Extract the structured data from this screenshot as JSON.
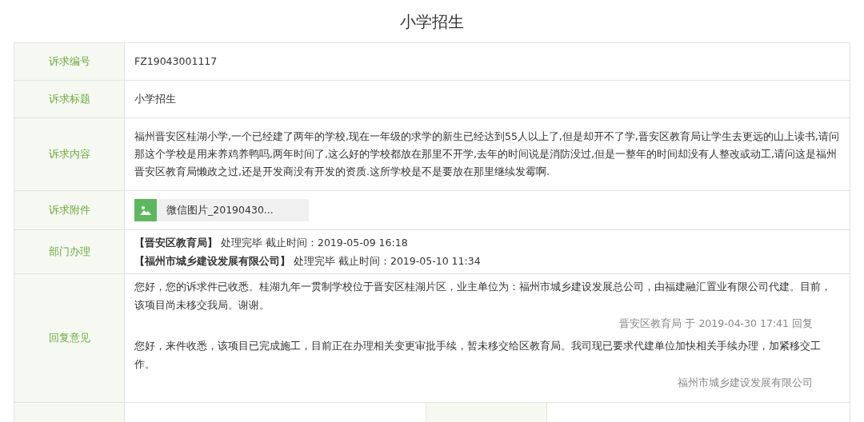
{
  "title": "小学招生",
  "rows": [
    {
      "kind": "text",
      "label": "诉求编号",
      "value": "FZ19043001117"
    },
    {
      "kind": "text",
      "label": "诉求标题",
      "value": "小学招生"
    },
    {
      "kind": "text",
      "label": "诉求内容",
      "value": "福州晋安区桂湖小学,一个已经建了两年的学校,现在一年级的求学的新生已经达到55人以上了,但是却开不了学,晋安区教育局让学生去更远的山上读书,请问那这个学校是用来养鸡养鸭吗,两年时间了,这么好的学校都放在那里不开学,去年的时间说是消防没过,但是一整年的时间却没有人整改或动工,请问这是福州晋安区教育局懒政之过,还是开发商没有开发的资质.这所学校是不是要放在那里继续发霉啊."
    },
    {
      "kind": "attachment",
      "label": "诉求附件",
      "file": "微信图片_20190430..."
    },
    {
      "kind": "lines",
      "label": "部门办理",
      "lines": [
        "**【晋安区教育局】** 处理完毕 截止时间：2019-05-09 16:18",
        "**【福州市城乡建设发展有限公司】** 处理完毕 截止时间：2019-05-10 11:34"
      ]
    },
    {
      "kind": "replies",
      "label": "回复意见",
      "replies": [
        {
          "text": "您好，您的诉求件已收悉。桂湖九年一贯制学校位于晋安区桂湖片区，业主单位为：福州市城乡建设发展总公司，由福建融汇置业有限公司代建。目前，该项目尚未移交我局。谢谢。",
          "signature": "晋安区教育局 于 2019-04-30 17:41 回复"
        },
        {
          "text": "您好，来件收悉，该项目已完成施工，目前正在办理相关变更审批手续，暂未移交给区教育局。我司现已要求代建单位加快相关手续办理，加紧移交工作。",
          "signature": "福州市城乡建设发展有限公司"
        }
      ]
    }
  ]
}
